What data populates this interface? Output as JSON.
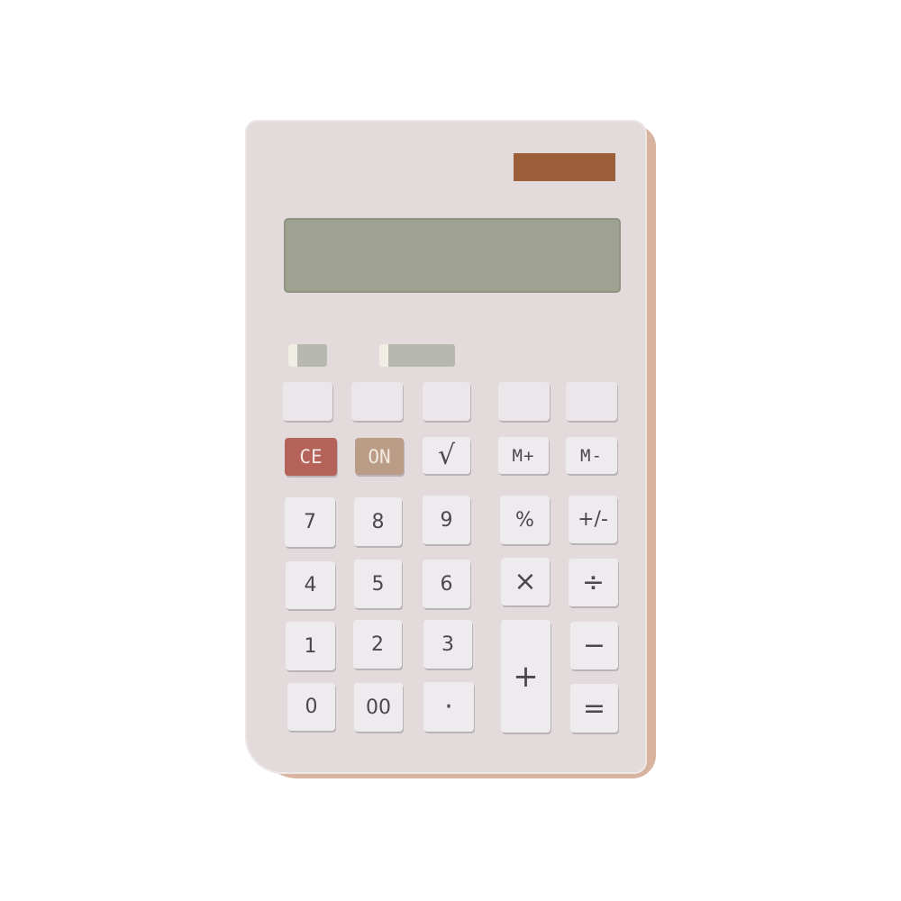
{
  "calculator": {
    "top_row": [
      "",
      "",
      "",
      "",
      ""
    ],
    "row2": {
      "ce": "CE",
      "on": "ON",
      "sqrt": "√",
      "m_plus": "M+",
      "m_minus": "M-"
    },
    "row3": {
      "seven": "7",
      "eight": "8",
      "nine": "9",
      "percent": "%",
      "plus_minus": "+/-"
    },
    "row4": {
      "four": "4",
      "five": "5",
      "six": "6",
      "multiply": "×",
      "divide": "÷"
    },
    "row5": {
      "one": "1",
      "two": "2",
      "three": "3",
      "minus": "−"
    },
    "row6": {
      "zero": "0",
      "double_zero": "00",
      "decimal": "·",
      "equals": "="
    },
    "plus": "+",
    "colors": {
      "body": "#e2dadb",
      "shadow": "#d8b4a0",
      "solar_panel": "#9b5f39",
      "display": "#9fa191",
      "ce_key": "#b5625b",
      "on_key": "#bb9c86",
      "key": "#eeebee"
    }
  }
}
